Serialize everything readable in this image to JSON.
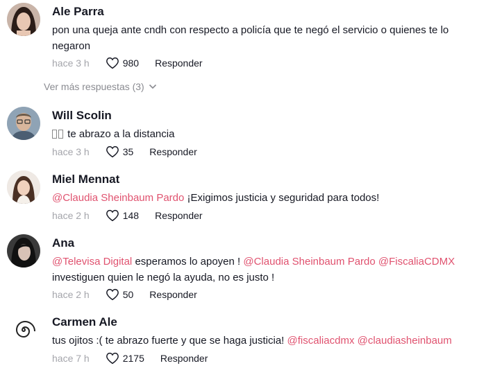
{
  "comments": [
    {
      "name": "Ale Parra",
      "text": "pon una queja ante cndh con respecto a policía que te negó el servicio o quienes te lo negaron",
      "time": "hace 3 h",
      "likes": "980",
      "reply": "Responder",
      "more_replies": "Ver más respuestas (3)"
    },
    {
      "name": "Will Scolin",
      "text": "te abrazo a la distancia",
      "time": "hace 3 h",
      "likes": "35",
      "reply": "Responder"
    },
    {
      "name": "Miel Mennat",
      "mention1": "@Claudia Sheinbaum Pardo",
      "text": " ¡Exigimos justicia y seguridad para todos!",
      "time": "hace 2 h",
      "likes": "148",
      "reply": "Responder"
    },
    {
      "name": "Ana",
      "mention1": "@Televisa Digital",
      "text1": " esperamos lo apoyen ! ",
      "mention2": "@Claudia Sheinbaum Pardo",
      "mention3": "@FiscaliaCDMX",
      "text2": "investiguen quien le negó la ayuda, no es justo !",
      "time": "hace 2 h",
      "likes": "50",
      "reply": "Responder"
    },
    {
      "name": "Carmen Ale",
      "text": "tus ojitos :( te abrazo fuerte y que se haga justicia! ",
      "mention1": "@fiscaliacdmx",
      "mention2": "@claudiasheinbaum",
      "time": "hace 7 h",
      "likes": "2175",
      "reply": "Responder"
    }
  ],
  "colors": {
    "mention": "#e0526f",
    "meta": "#8a8b91"
  },
  "icons": {
    "like": "heart-outline-icon",
    "more": "chevron-down-icon"
  }
}
